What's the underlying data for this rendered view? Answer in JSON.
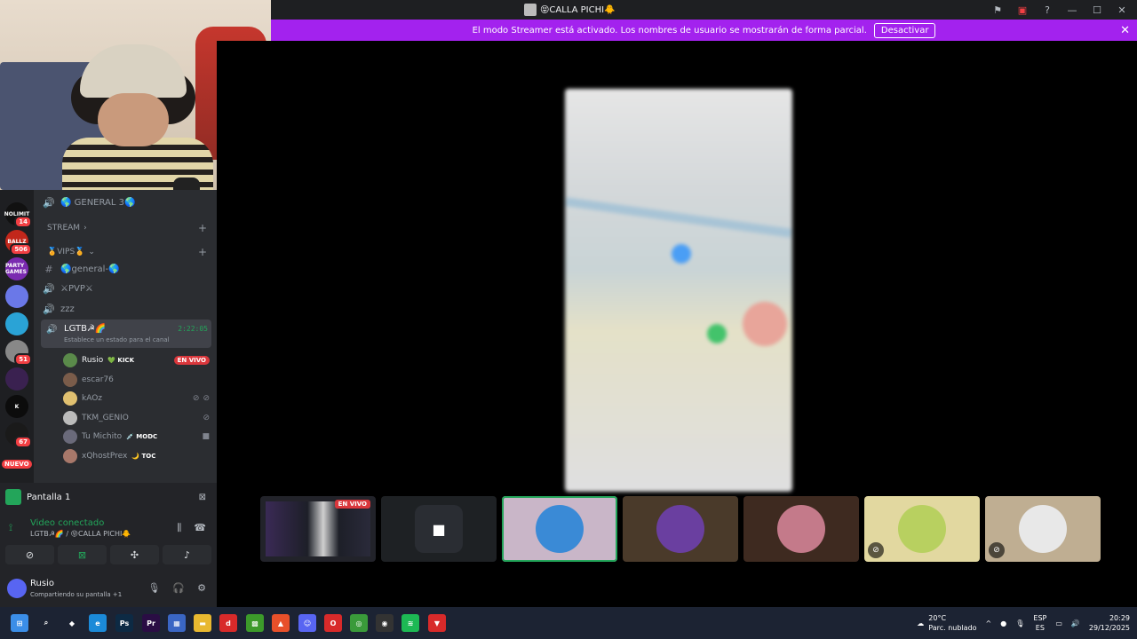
{
  "window": {
    "title": "😝CALLA PICHI🐥"
  },
  "banner": {
    "message": "El modo Streamer está activado. Los nombres de usuario se mostrarán de forma parcial.",
    "button": "Desactivar"
  },
  "servers": [
    {
      "label": "NOLIMIT",
      "badge": "14",
      "color": "#111111"
    },
    {
      "label": "BALLZ",
      "badge": "506",
      "color": "#c2271b"
    },
    {
      "label": "PARTY GAMES",
      "badge": "",
      "color": "#7a2ab0"
    },
    {
      "label": "",
      "badge": "",
      "color": "#6a78e8"
    },
    {
      "label": "",
      "badge": "",
      "color": "#2aa3d6"
    },
    {
      "label": "",
      "badge": "51",
      "color": "#888888"
    },
    {
      "label": "",
      "badge": "",
      "color": "#3a2150"
    },
    {
      "label": "K",
      "badge": "",
      "color": "#0c0c0c"
    },
    {
      "label": "",
      "badge": "67",
      "color": "#1a1a1a"
    }
  ],
  "new_label": "NUEVO",
  "channels": {
    "general3": "🌎 GENERAL 3🌎",
    "stream_cat": "STREAM",
    "vips_cat": "🏅VIPS🏅",
    "general": "🌎general-🌎",
    "pvp": "⚔PVP⚔",
    "zzz": "zzz",
    "active": {
      "name": "LGTB☭🌈",
      "timer": "2:22:05",
      "status": "Establece un estado para el canal"
    }
  },
  "voice_users": [
    {
      "name": "Rusio",
      "tag": "💚 KICK",
      "live": "EN VIVO",
      "color": "#5a8a4a"
    },
    {
      "name": "escar76",
      "tag": "",
      "live": "",
      "color": "#7a5c4a"
    },
    {
      "name": "kAOz",
      "tag": "",
      "live": "",
      "color": "#e0c070"
    },
    {
      "name": "TKM_GENIO",
      "tag": "",
      "live": "",
      "color": "#bbbbbb"
    },
    {
      "name": "Tu Michito",
      "tag": "💉 MODC",
      "live": "",
      "color": "#6a6a7a"
    },
    {
      "name": "xQhostPrex",
      "tag": "🌙 TOC",
      "live": "",
      "color": "#a8786a"
    }
  ],
  "share": {
    "screen_label": "Pantalla 1",
    "voice_status": "Video conectado",
    "voice_channel": "LGTB☭🌈 / 😝CALLA PICHI🐥"
  },
  "me": {
    "name": "Rusio",
    "status": "Compartiendo su pantalla +1"
  },
  "tiles": [
    {
      "kind": "stream",
      "live": "EN VIVO",
      "color": "#22232a"
    },
    {
      "kind": "camera",
      "live": "",
      "color": "#1e2124"
    },
    {
      "kind": "avatar",
      "live": "",
      "color": "#c9b6c8"
    },
    {
      "kind": "avatar",
      "live": "",
      "color": "#4a3a2a"
    },
    {
      "kind": "avatar",
      "live": "",
      "color": "#3e2a20"
    },
    {
      "kind": "avatar",
      "live": "",
      "color": "#e2d8a0"
    },
    {
      "kind": "avatar",
      "live": "",
      "color": "#bfae92"
    }
  ],
  "taskbar": {
    "weather_temp": "20°C",
    "weather_desc": "Parc. nublado",
    "lang1": "ESP",
    "lang2": "ES",
    "time": "20:29",
    "date": "29/12/2025"
  },
  "colors": {
    "accent_green": "#23a55a",
    "banner_purple": "#a322ee",
    "live_red": "#da373c"
  }
}
